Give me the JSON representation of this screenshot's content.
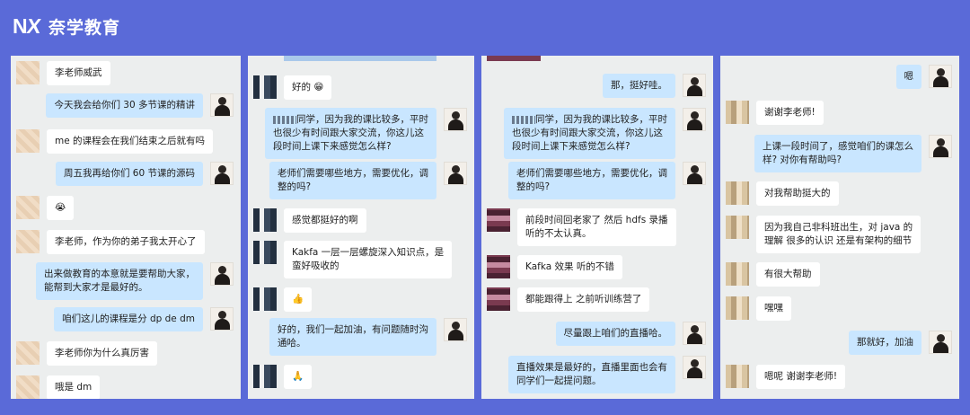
{
  "brand": {
    "logo": "NX",
    "name": "奈学教育"
  },
  "panel1": {
    "messages": [
      {
        "side": "left",
        "avatar": "beige",
        "text": "李老师威武"
      },
      {
        "side": "right",
        "avatar": "teacher",
        "text": "今天我会给你们 30 多节课的精讲"
      },
      {
        "side": "left",
        "avatar": "beige",
        "text": "me 的课程会在我们结束之后就有吗"
      },
      {
        "side": "right",
        "avatar": "teacher",
        "text": "周五我再给你们 60 节课的源码"
      },
      {
        "side": "left",
        "avatar": "beige",
        "text": "😭"
      },
      {
        "side": "left",
        "avatar": "beige",
        "text": "李老师，作为你的弟子我太开心了"
      },
      {
        "side": "right",
        "avatar": "teacher",
        "text": "出来做教育的本意就是要帮助大家，\n能帮到大家才是最好的。"
      },
      {
        "side": "right",
        "avatar": "teacher",
        "text": "咱们这儿的课程是分 dp de dm"
      },
      {
        "side": "left",
        "avatar": "beige",
        "text": "李老师你为什么真厉害"
      },
      {
        "side": "left",
        "avatar": "beige",
        "text": "哦是 dm"
      }
    ]
  },
  "panel2": {
    "messages": [
      {
        "side": "left",
        "avatar": "dark",
        "text": "好的 😁"
      },
      {
        "side": "right",
        "avatar": "teacher",
        "text": "同学，因为我的课比较多，平时\n也很少有时间跟大家交流，你这儿这\n段时间上课下来感觉怎么样?"
      },
      {
        "side": "right",
        "avatar": "teacher",
        "text": "老师们需要哪些地方，需要优化，调\n整的吗?"
      },
      {
        "side": "left",
        "avatar": "dark",
        "text": "感觉都挺好的啊"
      },
      {
        "side": "left",
        "avatar": "dark",
        "text": "Kakfa 一层一层螺旋深入知识点，是\n蛮好吸收的"
      },
      {
        "side": "left",
        "avatar": "dark",
        "text": "👍"
      },
      {
        "side": "right",
        "avatar": "teacher",
        "text": "好的，我们一起加油，有问题随时沟\n通哈。"
      },
      {
        "side": "left",
        "avatar": "dark",
        "text": "🙏"
      }
    ]
  },
  "panel3": {
    "messages": [
      {
        "side": "right",
        "avatar": "teacher",
        "text": "那，挺好哇。"
      },
      {
        "side": "right",
        "avatar": "teacher",
        "text": "同学，因为我的课比较多，平时\n也很少有时间跟大家交流，你这儿这\n段时间上课下来感觉怎么样?"
      },
      {
        "side": "right",
        "avatar": "teacher",
        "text": "老师们需要哪些地方，需要优化，调\n整的吗?"
      },
      {
        "side": "left",
        "avatar": "maroon",
        "text": "前段时间回老家了  然后 hdfs 录播\n听的不太认真。"
      },
      {
        "side": "left",
        "avatar": "maroon",
        "text": "Kafka 效果  听的不错"
      },
      {
        "side": "left",
        "avatar": "maroon",
        "text": "都能跟得上  之前听训练营了"
      },
      {
        "side": "right",
        "avatar": "teacher",
        "text": "尽量跟上咱们的直播哈。"
      },
      {
        "side": "right",
        "avatar": "teacher",
        "text": "直播效果是最好的，直播里面也会有\n同学们一起提问题。"
      }
    ]
  },
  "panel4": {
    "messages": [
      {
        "side": "right",
        "avatar": "teacher",
        "text": "嗯"
      },
      {
        "side": "left",
        "avatar": "blur",
        "text": "谢谢李老师!"
      },
      {
        "side": "right",
        "avatar": "teacher",
        "text": "上课一段时间了，感觉咱们的课怎么\n样? 对你有帮助吗?"
      },
      {
        "side": "left",
        "avatar": "blur",
        "text": "对我帮助挺大的"
      },
      {
        "side": "left",
        "avatar": "blur",
        "text": "因为我自己非科班出生，对 java 的\n理解  很多的认识  还是有架构的细节"
      },
      {
        "side": "left",
        "avatar": "blur",
        "text": "有很大帮助"
      },
      {
        "side": "left",
        "avatar": "blur",
        "text": "嘿嘿"
      },
      {
        "side": "right",
        "avatar": "teacher",
        "text": "那就好，加油"
      },
      {
        "side": "left",
        "avatar": "blur",
        "text": "嗯呢  谢谢李老师!"
      }
    ]
  }
}
